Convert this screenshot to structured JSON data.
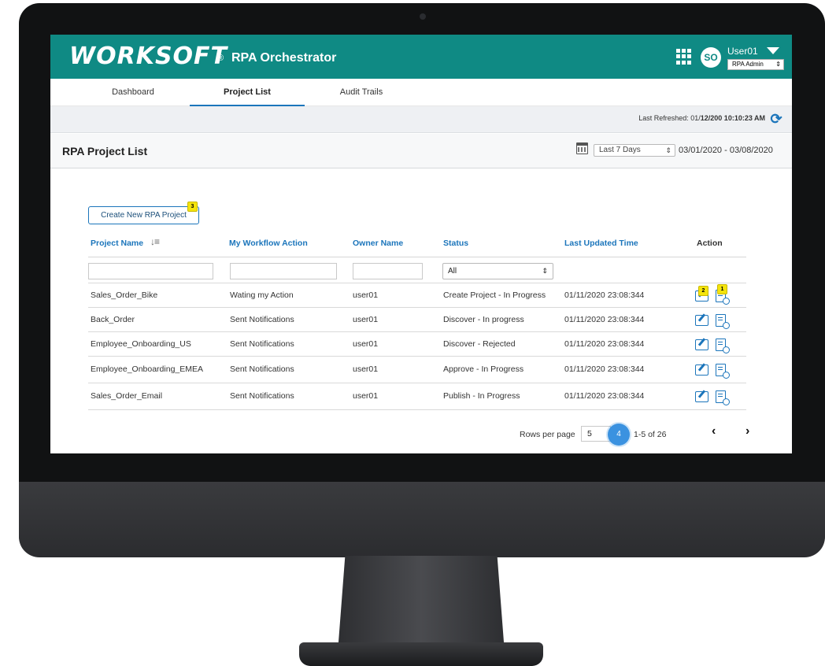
{
  "header": {
    "logo_text": "WORKSOFT",
    "logo_reg": "®",
    "app_name": "RPA Orchestrator",
    "avatar_initials": "SO",
    "user_name": "User01",
    "role": "RPA Admin"
  },
  "tabs": [
    {
      "label": "Dashboard",
      "active": false
    },
    {
      "label": "Project List",
      "active": true
    },
    {
      "label": "Audit Trails",
      "active": false
    }
  ],
  "refresh": {
    "label": "Last Refreshed: 01/",
    "value": "12/200 10:10:23 AM"
  },
  "page": {
    "title": "RPA Project List",
    "range_option": "Last 7 Days",
    "date_range": "03/01/2020 - 03/08/2020"
  },
  "toolbar": {
    "create_label": "Create New RPA Project",
    "create_badge": "3"
  },
  "table": {
    "columns": [
      "Project Name",
      "My Workflow Action",
      "Owner Name",
      "Status",
      "Last Updated Time",
      "Action"
    ],
    "status_filter": "All",
    "rows": [
      {
        "name": "Sales_Order_Bike",
        "workflow": "Wating my Action",
        "owner": "user01",
        "status": "Create Project - In Progress",
        "updated": "01/11/2020 23:08:344"
      },
      {
        "name": "Back_Order",
        "workflow": "Sent Notifications",
        "owner": "user01",
        "status": "Discover - In progress",
        "updated": "01/11/2020 23:08:344"
      },
      {
        "name": "Employee_Onboarding_US",
        "workflow": "Sent Notifications",
        "owner": "user01",
        "status": "Discover - Rejected",
        "updated": "01/11/2020 23:08:344"
      },
      {
        "name": "Employee_Onboarding_EMEA",
        "workflow": "Sent Notifications",
        "owner": "user01",
        "status": "Approve - In Progress",
        "updated": "01/11/2020 23:08:344"
      },
      {
        "name": "Sales_Order_Email",
        "workflow": "Sent Notifications",
        "owner": "user01",
        "status": "Publish - In Progress",
        "updated": "01/11/2020 23:08:344"
      }
    ],
    "action_badges": {
      "edit": "2",
      "log": "1"
    }
  },
  "pagination": {
    "rows_label": "Rows per page",
    "rows_value": "5",
    "step_marker": "4",
    "range": "1-5 of 26",
    "prev": "‹",
    "next": "›"
  },
  "colors": {
    "brand": "#0f8a84",
    "accent": "#1b75bb",
    "callout": "#f4e40c"
  }
}
